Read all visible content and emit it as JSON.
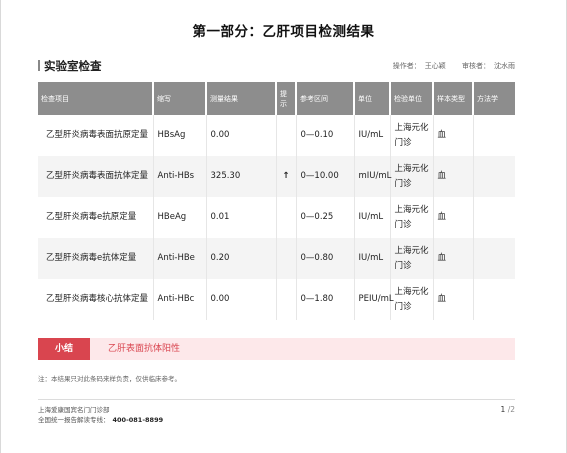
{
  "document": {
    "title": "第一部分：乙肝项目检测结果"
  },
  "section": {
    "title": "实验室检查",
    "operator_label": "操作者：",
    "operator_name": "王心颖",
    "reviewer_label": "审核者：",
    "reviewer_name": "沈水雨"
  },
  "table": {
    "headers": [
      "检查项目",
      "缩写",
      "测量结果",
      "提示",
      "参考区间",
      "单位",
      "检验单位",
      "样本类型",
      "方法学"
    ],
    "rows": [
      {
        "name": "乙型肝炎病毒表面抗原定量",
        "abbr": "HBsAg",
        "result": "0.00",
        "hint": "",
        "range": "0—0.10",
        "unit": "IU/mL",
        "lab": "上海元化门诊",
        "sample": "血",
        "method": ""
      },
      {
        "name": "乙型肝炎病毒表面抗体定量",
        "abbr": "Anti-HBs",
        "result": "325.30",
        "hint": "↑",
        "range": "0—10.00",
        "unit": "mIU/mL",
        "lab": "上海元化门诊",
        "sample": "血",
        "method": ""
      },
      {
        "name": "乙型肝炎病毒e抗原定量",
        "abbr": "HBeAg",
        "result": "0.01",
        "hint": "",
        "range": "0—0.25",
        "unit": "IU/mL",
        "lab": "上海元化门诊",
        "sample": "血",
        "method": ""
      },
      {
        "name": "乙型肝炎病毒e抗体定量",
        "abbr": "Anti-HBe",
        "result": "0.20",
        "hint": "",
        "range": "0—0.80",
        "unit": "IU/mL",
        "lab": "上海元化门诊",
        "sample": "血",
        "method": ""
      },
      {
        "name": "乙型肝炎病毒核心抗体定量",
        "abbr": "Anti-HBc",
        "result": "0.00",
        "hint": "",
        "range": "0—1.80",
        "unit": "PEIU/mL",
        "lab": "上海元化门诊",
        "sample": "血",
        "method": ""
      }
    ]
  },
  "summary": {
    "label": "小结",
    "text": "乙肝表面抗体阳性"
  },
  "note": "注：本结果只对此条码来样负责，仅供临床参考。",
  "footer": {
    "company": "上海爱康国宾名门门诊部",
    "hotline_label": "全国统一报告解读专线：",
    "hotline": "400-081-8899",
    "page_current": "1",
    "page_total": "/2"
  },
  "colors": {
    "header_bg": "#8d8d8d",
    "summary_tag": "#d9454f",
    "summary_bg": "#fde8ea",
    "alert_arrow": "#d23b3b"
  }
}
